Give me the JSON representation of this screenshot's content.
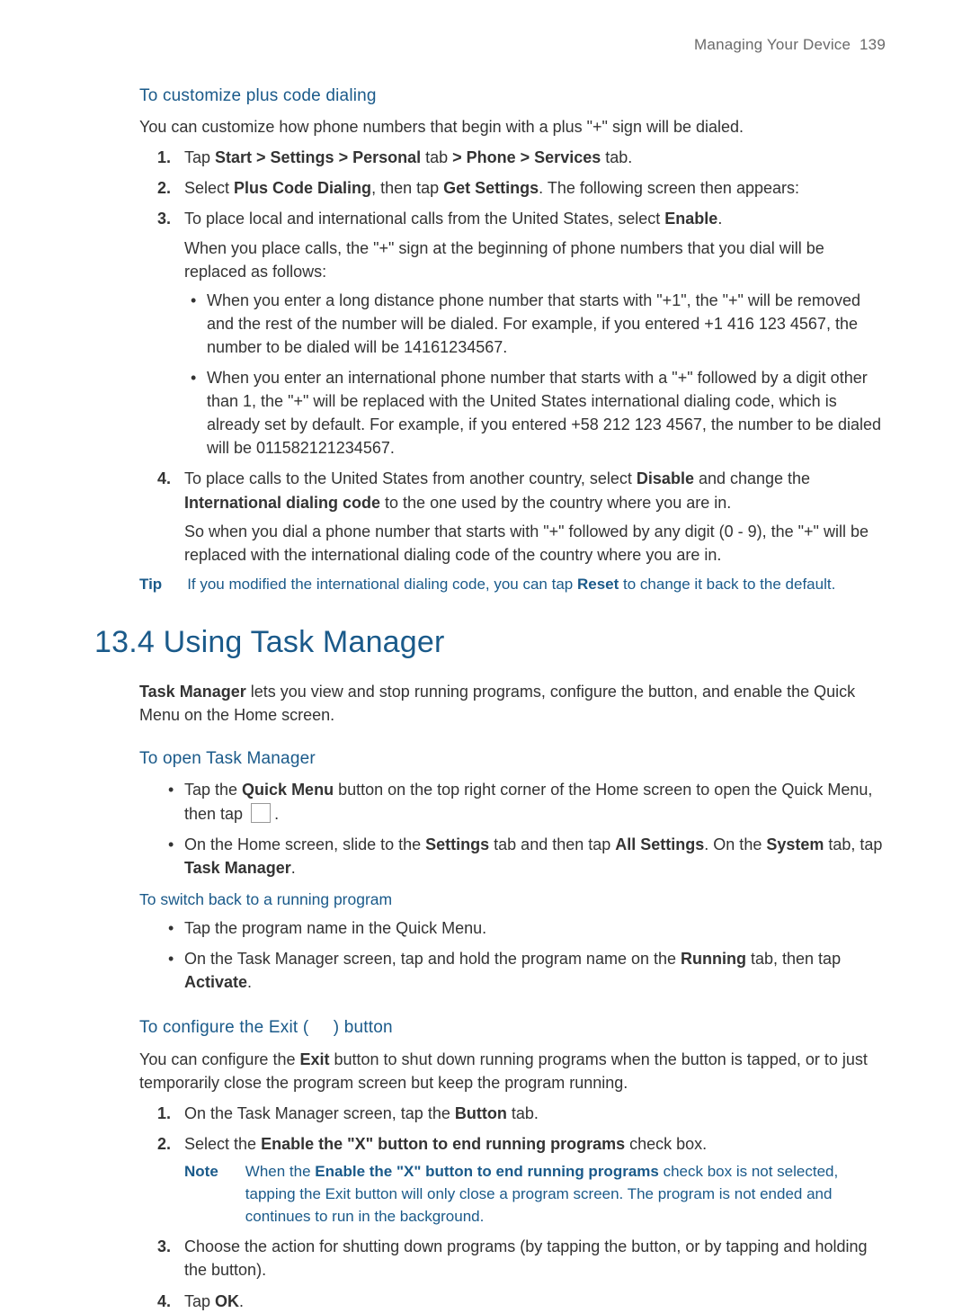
{
  "header": {
    "chapter": "Managing Your Device",
    "page": "139"
  },
  "sec1_title": "To customize plus code dialing",
  "sec1_intro": "You can customize how phone numbers that begin with a plus \"+\" sign will be dialed.",
  "sec1": {
    "n1a": "Tap ",
    "n1b": "Start > Settings > Personal",
    "n1c": " tab ",
    "n1d": "> Phone > Services",
    "n1e": " tab.",
    "n2a": "Select ",
    "n2b": "Plus Code Dialing",
    "n2c": ", then tap ",
    "n2d": "Get Settings",
    "n2e": ". The following screen then appears:",
    "n3a": "To place local and international calls from the United States, select ",
    "n3b": "Enable",
    "n3c": ".",
    "n3_follow": "When you place calls, the \"+\" sign at the beginning of phone numbers that you dial will be replaced as follows:",
    "n3_bul1": "When you enter a long distance phone number that starts with \"+1\", the \"+\" will be removed and the rest of the number will be dialed. For example, if you entered +1 416 123 4567, the number to be dialed will be 14161234567.",
    "n3_bul2": "When you enter an international phone number that starts with a \"+\" followed by a digit other than 1, the \"+\" will be replaced with the United States international dialing code, which is already set by default. For example, if you entered +58 212 123 4567, the number to be dialed will be 011582121234567.",
    "n4a": "To place calls to the United States from another country, select ",
    "n4b": "Disable",
    "n4c": " and change the ",
    "n4d": "International dialing code",
    "n4e": " to the one used by the country where you are in.",
    "n4_follow": "So when you dial a phone number that starts with \"+\" followed by any digit (0 - 9), the \"+\" will be replaced with the international dialing code of the country where you are in."
  },
  "tip_label": "Tip",
  "tip_a": "If you modified the international dialing code, you can tap ",
  "tip_b": "Reset",
  "tip_c": " to change it back to the default.",
  "main_heading": "13.4  Using Task Manager",
  "tm_intro_a": "Task Manager",
  "tm_intro_b": " lets you view and stop running programs, configure the        button, and enable the Quick Menu on the Home screen.",
  "sec2_title": "To open Task Manager",
  "sec2_b1a": "Tap the ",
  "sec2_b1b": "Quick Menu",
  "sec2_b1c": " button on the top right corner of the Home screen to open the Quick Menu, then tap ",
  "sec2_b1d": ".",
  "sec2_b2a": "On the Home screen, slide to the ",
  "sec2_b2b": "Settings",
  "sec2_b2c": " tab and then tap ",
  "sec2_b2d": "All Settings",
  "sec2_b2e": ". On the ",
  "sec2_b2f": "System",
  "sec2_b2g": " tab, tap ",
  "sec2_b2h": "Task Manager",
  "sec2_b2i": ".",
  "sec3_title": "To switch back to a running program",
  "sec3_b1": "Tap the program name in the Quick Menu.",
  "sec3_b2a": "On the Task Manager screen, tap and hold the program name on the ",
  "sec3_b2b": "Running",
  "sec3_b2c": " tab, then tap ",
  "sec3_b2d": "Activate",
  "sec3_b2e": ".",
  "sec4_title_a": "To configure the Exit (",
  "sec4_title_b": ") button",
  "sec4_intro_a": "You can configure the ",
  "sec4_intro_b": "Exit",
  "sec4_intro_c": " button to shut down running programs when the button is tapped, or to just temporarily close the program screen but keep the program running.",
  "sec4_n1a": "On the Task Manager screen, tap the ",
  "sec4_n1b": "Button",
  "sec4_n1c": " tab.",
  "sec4_n2a": "Select the ",
  "sec4_n2b": "Enable the \"X\" button to end running programs",
  "sec4_n2c": " check box.",
  "note_label": "Note",
  "note_a": "When the ",
  "note_b": "Enable the \"X\" button to end running programs",
  "note_c": " check box is not selected, tapping the Exit button will only close a program screen. The program is not ended and continues to run in the background.",
  "sec4_n3": "Choose the action for shutting down programs (by tapping the        button, or by tapping and holding the        button).",
  "sec4_n4a": "Tap ",
  "sec4_n4b": "OK",
  "sec4_n4c": "."
}
